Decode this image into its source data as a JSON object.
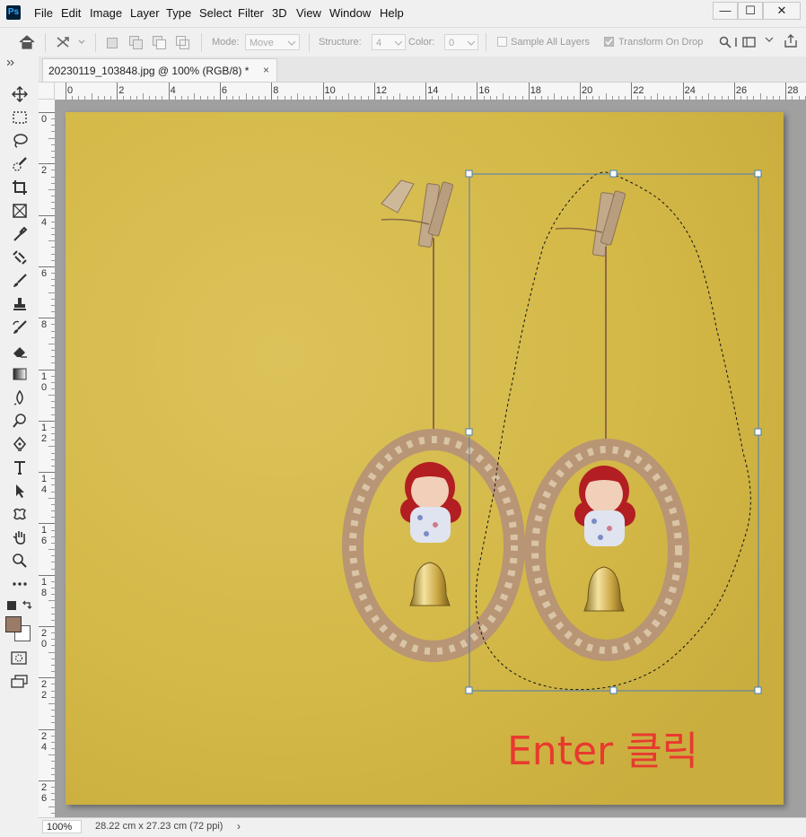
{
  "app": {
    "logo": "Ps"
  },
  "menu": [
    "File",
    "Edit",
    "Image",
    "Layer",
    "Type",
    "Select",
    "Filter",
    "3D",
    "View",
    "Window",
    "Help"
  ],
  "window_controls": {
    "minimize": "—",
    "restore": "☐",
    "close": "✕"
  },
  "options": {
    "mode_label": "Mode:",
    "mode_value": "Move",
    "structure_label": "Structure:",
    "structure_value": "4",
    "color_label": "Color:",
    "color_value": "0",
    "sample_all_layers": "Sample All Layers",
    "sample_all_layers_checked": false,
    "transform_on_drop": "Transform On Drop",
    "transform_on_drop_checked": true
  },
  "document_tab": {
    "title": "20230119_103848.jpg @ 100% (RGB/8) *",
    "close": "×"
  },
  "ruler": {
    "h_labels": [
      "0",
      "2",
      "4",
      "6",
      "8",
      "10",
      "12",
      "14",
      "16",
      "18",
      "20",
      "22",
      "24",
      "26",
      "28"
    ],
    "v_labels": [
      "0",
      "2",
      "4",
      "6",
      "8",
      "10",
      "12",
      "14",
      "16",
      "18",
      "20",
      "22",
      "24",
      "26"
    ]
  },
  "annotation": {
    "text": "Enter 클릭",
    "color": "#e83a2f"
  },
  "colors": {
    "foreground": "#9a7b68",
    "background": "#ffffff",
    "canvas": "#d6b94a",
    "selection_box": "#4a7fb5"
  },
  "toolbar_icons": [
    "move-icon",
    "marquee-icon",
    "lasso-icon",
    "quick-selection-icon",
    "crop-icon",
    "frame-icon",
    "eyedropper-icon",
    "healing-icon",
    "brush-icon",
    "stamp-icon",
    "history-brush-icon",
    "eraser-icon",
    "gradient-icon",
    "blur-icon",
    "dodge-icon",
    "pen-icon",
    "type-icon",
    "path-selection-icon",
    "shape-icon",
    "hand-icon",
    "zoom-icon",
    "more-tools-icon"
  ],
  "status": {
    "zoom": "100%",
    "doc_size": "28.22 cm x 27.23 cm (72 ppi)",
    "arrow": "›"
  }
}
